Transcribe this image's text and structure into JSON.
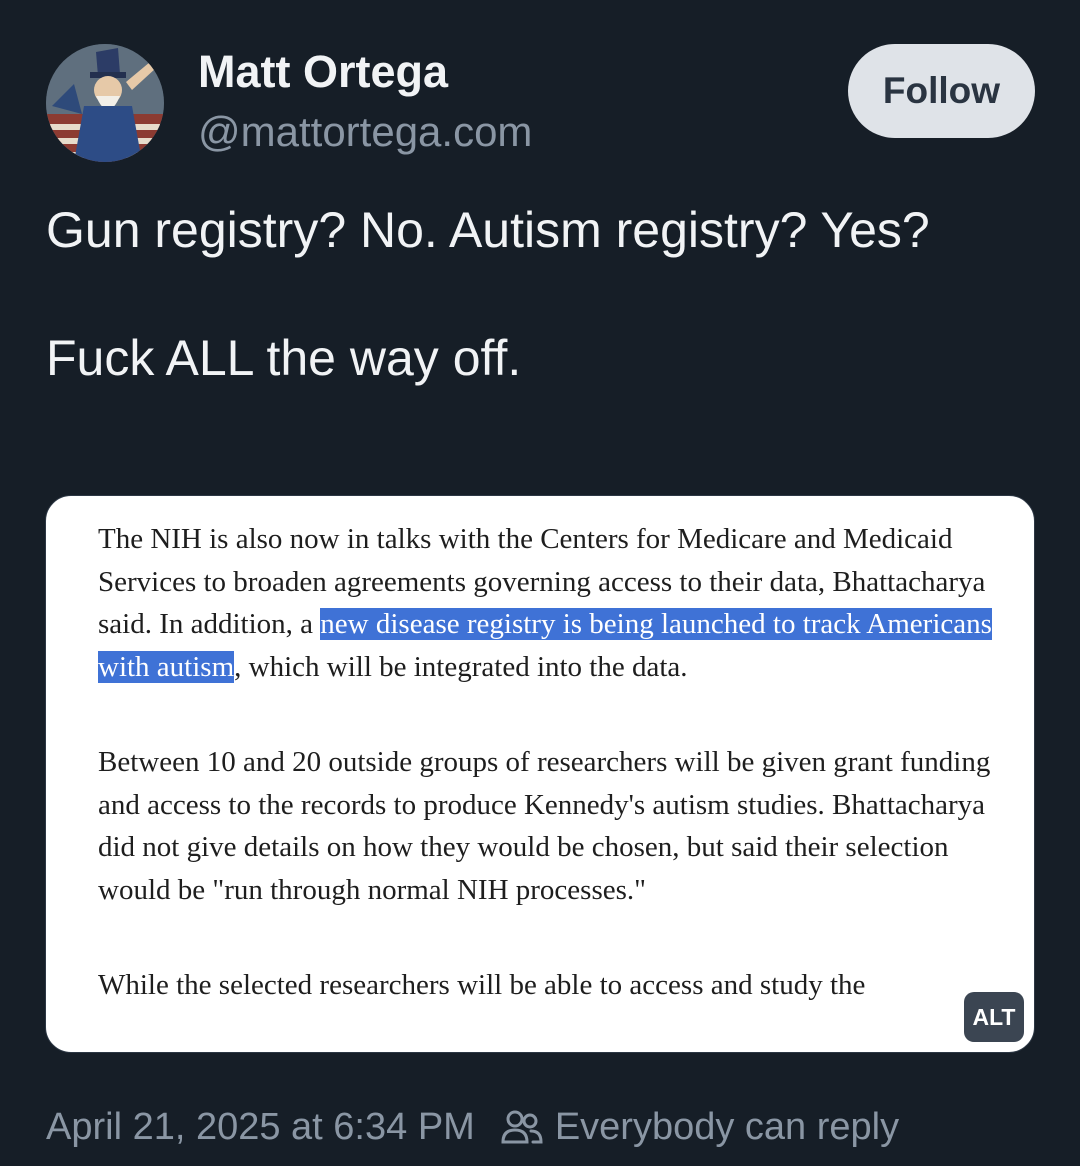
{
  "author": {
    "display_name": "Matt Ortega",
    "handle": "@mattortega.com",
    "avatar_icon": "uncle-sam-avatar-icon"
  },
  "follow_label": "Follow",
  "post": {
    "line1": "Gun registry? No. Autism registry? Yes?",
    "line2": "Fuck ALL the way off."
  },
  "embed": {
    "para1_before": "The NIH is also now in talks with the Centers for Medicare and Medicaid Services to broaden agreements governing access to their data, Bhattacharya said. In addition, a ",
    "para1_highlight": "new disease registry is being launched to track Americans with autism",
    "para1_after": ", which will be integrated into the data.",
    "para2": "Between 10 and 20 outside groups of researchers will be given grant funding and access to the records to produce Kennedy's autism studies. Bhattacharya did not give details on how they would be chosen, but said their selection would be \"run through normal NIH processes.\"",
    "para3_partial": "While the selected researchers will be able to access and study the",
    "highlight_color": "#3f72d6",
    "alt_label": "ALT"
  },
  "footer": {
    "timestamp": "April 21, 2025 at 6:34 PM",
    "reply_setting": "Everybody can reply",
    "reply_icon": "people-icon"
  },
  "colors": {
    "background": "#161e27",
    "text": "#f1f3f5",
    "muted": "#8a96a4",
    "follow_bg": "#dfe3e8"
  }
}
